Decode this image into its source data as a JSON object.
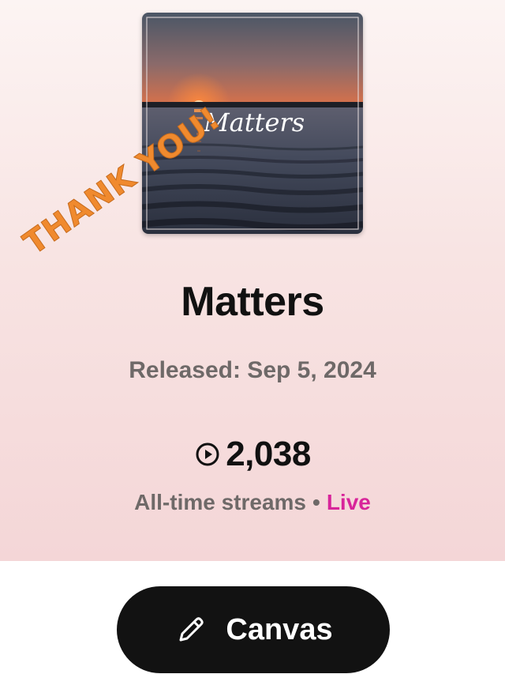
{
  "artwork": {
    "title_text": "Matters",
    "overlay_text": "THANK YOU!"
  },
  "track": {
    "title": "Matters",
    "released": "Released: Sep 5, 2024"
  },
  "stats": {
    "play_icon": "play-circle-icon",
    "count": "2,038",
    "label": "All-time streams",
    "separator": "•",
    "live": "Live"
  },
  "canvas_button": {
    "icon": "pencil-icon",
    "label": "Canvas"
  },
  "colors": {
    "live": "#d8249a",
    "stamp": "#f08a2e",
    "button_bg": "#121212"
  }
}
